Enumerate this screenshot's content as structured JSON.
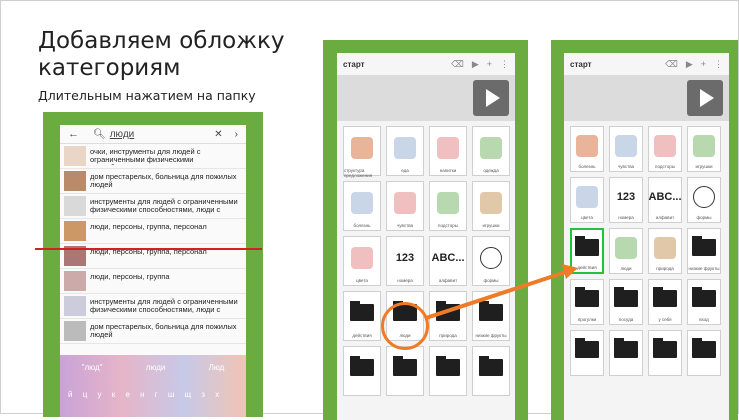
{
  "slide": {
    "title_line1": "Добавляем обложку",
    "title_line2": "категориям",
    "subtitle": "Длительным нажатием на папку"
  },
  "search_screen": {
    "query": "люди",
    "results": [
      {
        "text": "очки, инструменты для людей с ограниченными физическими способностями"
      },
      {
        "text": "дом престарелых, больница для пожилых людей"
      },
      {
        "text": "инструменты для людей с ограниченными физическими способностями, люди с ограниченн"
      },
      {
        "text": "люди, персоны, группа, персонал"
      },
      {
        "text": "люди, персоны, группа, персонал"
      },
      {
        "text": "люди, персоны, группа"
      },
      {
        "text": "инструменты для людей с ограниченными физическими способностями, люди с ограниченн"
      },
      {
        "text": "дом престарелых, больница для пожилых людей"
      }
    ],
    "suggestions": [
      "\"люд\"",
      "люди",
      "Люд"
    ],
    "keys": "й ц у к е н г ш щ з х"
  },
  "app_left": {
    "title": "старт",
    "rows": [
      [
        {
          "label": "структура предложения"
        },
        {
          "label": "еда"
        },
        {
          "label": "напитки"
        },
        {
          "label": "одежда"
        }
      ],
      [
        {
          "label": "болезнь"
        },
        {
          "label": "чувства"
        },
        {
          "label": "подсторы"
        },
        {
          "label": "игрушки"
        }
      ],
      [
        {
          "label": "цвета"
        },
        {
          "label": "номера",
          "big": "123"
        },
        {
          "label": "алфавит",
          "big": "ABC..."
        },
        {
          "label": "формы"
        }
      ],
      [
        {
          "label": "действия"
        },
        {
          "label": "люди"
        },
        {
          "label": "природа"
        },
        {
          "label": "низкие фрукты"
        }
      ],
      [
        {
          "label": ""
        },
        {
          "label": ""
        },
        {
          "label": ""
        },
        {
          "label": ""
        }
      ]
    ]
  },
  "app_right": {
    "title": "старт",
    "rows": [
      [
        {
          "label": "болезнь"
        },
        {
          "label": "чувства"
        },
        {
          "label": "подсторы"
        },
        {
          "label": "игрушки"
        }
      ],
      [
        {
          "label": "цвета"
        },
        {
          "label": "номера",
          "big": "123"
        },
        {
          "label": "алфавит",
          "big": "ABC..."
        },
        {
          "label": "формы"
        }
      ],
      [
        {
          "label": "действия"
        },
        {
          "label": "люди"
        },
        {
          "label": "природа"
        },
        {
          "label": "низкие фрукты"
        }
      ],
      [
        {
          "label": "прогулки"
        },
        {
          "label": "посуда"
        },
        {
          "label": "у себя"
        },
        {
          "label": "вход"
        }
      ],
      [
        {
          "label": ""
        },
        {
          "label": ""
        },
        {
          "label": ""
        },
        {
          "label": ""
        }
      ]
    ]
  },
  "colors": {
    "green": "#6aac3f",
    "arrow": "#ef7b27",
    "cut_line": "#d62020",
    "select": "#23c23c"
  }
}
